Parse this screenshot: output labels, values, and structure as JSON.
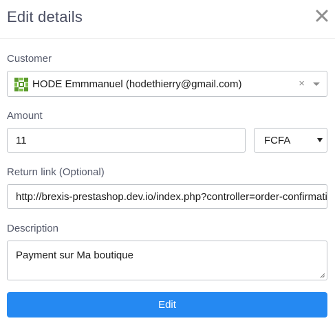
{
  "modal": {
    "title": "Edit details"
  },
  "form": {
    "customer": {
      "label": "Customer",
      "value": "HODE Emmmanuel (hodethierry@gmail.com)",
      "clear_glyph": "×"
    },
    "amount": {
      "label": "Amount",
      "value": "11",
      "currency": "FCFA"
    },
    "return_link": {
      "label": "Return link (Optional)",
      "value": "http://brexis-prestashop.dev.io/index.php?controller=order-confirmation"
    },
    "description": {
      "label": "Description",
      "value": "Payment sur Ma boutique"
    },
    "submit_label": "Edit"
  },
  "colors": {
    "primary": "#2589f2",
    "avatar_green": "#5b9a2d"
  },
  "icons": {
    "close": "close-icon",
    "avatar": "identicon-avatar",
    "dropdown": "chevron-down-icon"
  }
}
